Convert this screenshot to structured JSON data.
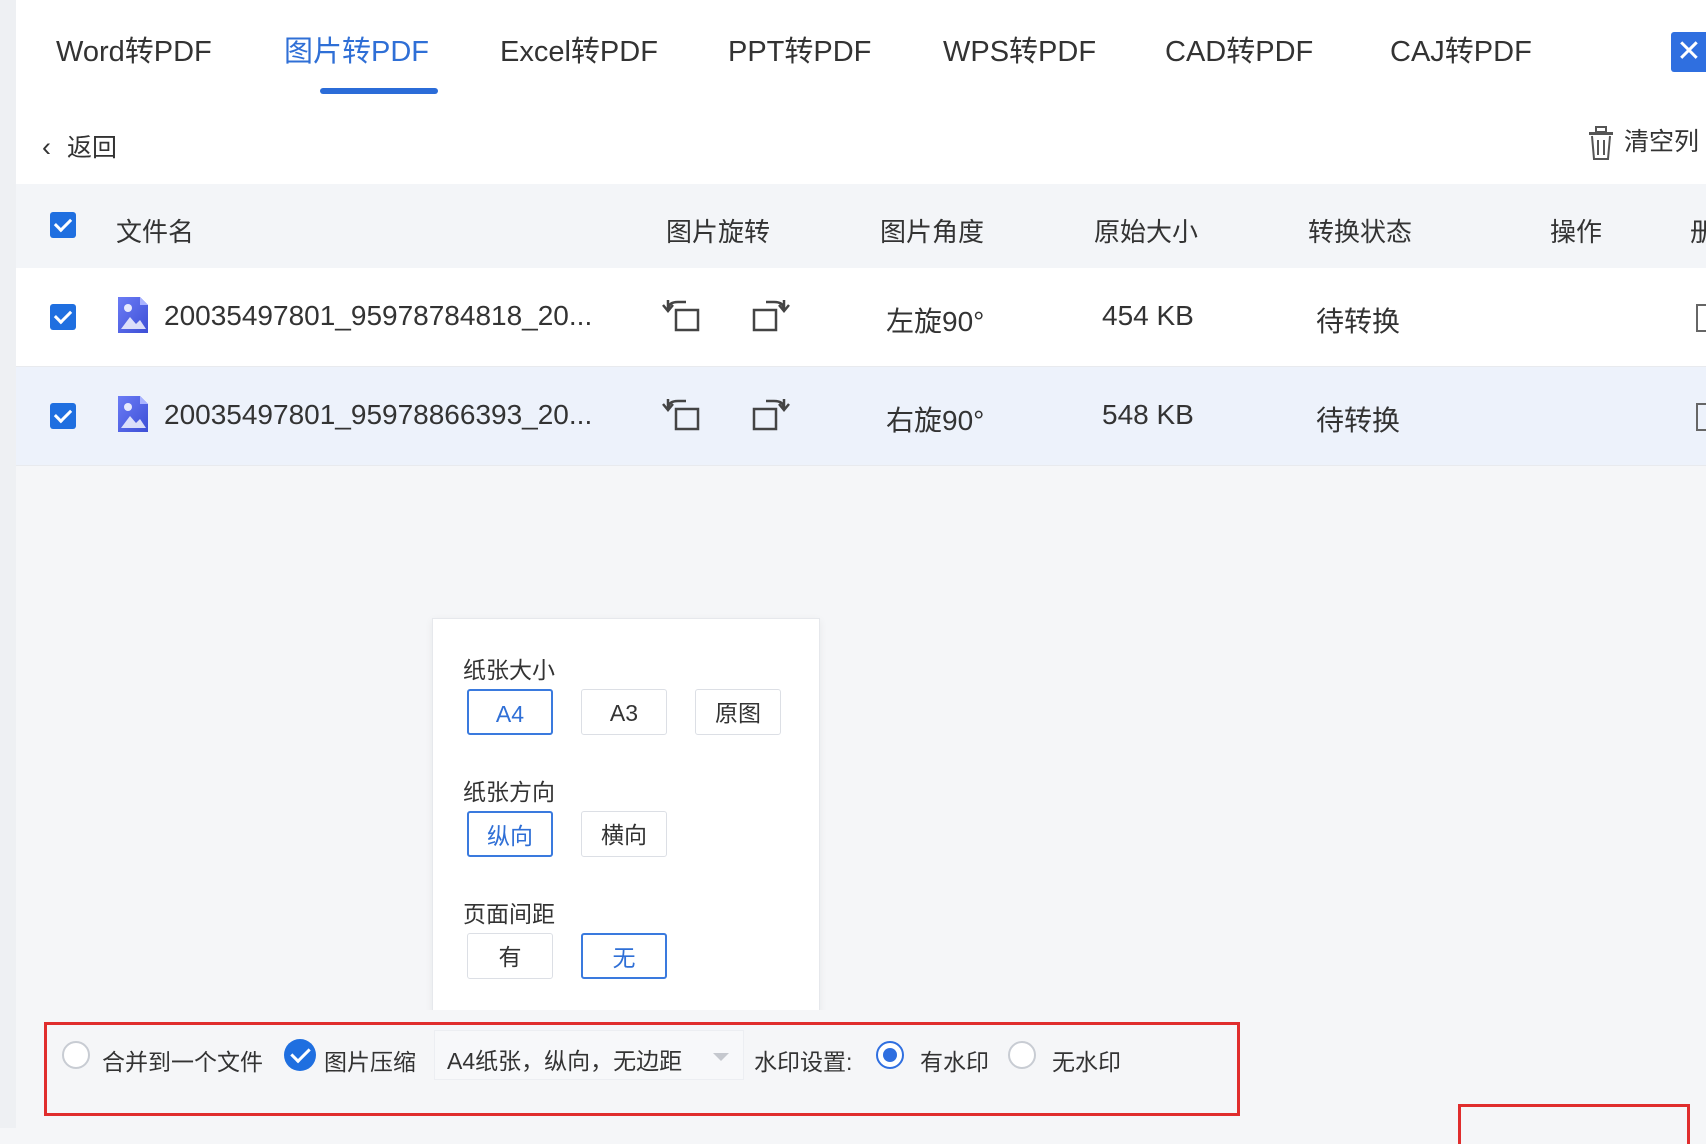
{
  "tabs": [
    {
      "label": "Word转PDF"
    },
    {
      "label": "图片转PDF"
    },
    {
      "label": "Excel转PDF"
    },
    {
      "label": "PPT转PDF"
    },
    {
      "label": "WPS转PDF"
    },
    {
      "label": "CAD转PDF"
    },
    {
      "label": "CAJ转PDF"
    }
  ],
  "active_tab_index": 1,
  "toolbar": {
    "back_label": "返回",
    "clear_label": "清空列"
  },
  "table": {
    "headers": {
      "filename": "文件名",
      "rotate": "图片旋转",
      "angle": "图片角度",
      "size": "原始大小",
      "status": "转换状态",
      "action": "操作",
      "delete": "册"
    },
    "rows": [
      {
        "name": "20035497801_95978784818_20...",
        "angle": "左旋90°",
        "size": "454 KB",
        "status": "待转换"
      },
      {
        "name": "20035497801_95978866393_20...",
        "angle": "右旋90°",
        "size": "548 KB",
        "status": "待转换"
      }
    ]
  },
  "popup": {
    "paper_size": {
      "label": "纸张大小",
      "options": [
        "A4",
        "A3",
        "原图"
      ],
      "selected": "A4"
    },
    "orientation": {
      "label": "纸张方向",
      "options": [
        "纵向",
        "横向"
      ],
      "selected": "纵向"
    },
    "margin": {
      "label": "页面间距",
      "options": [
        "有",
        "无"
      ],
      "selected": "无"
    }
  },
  "bottom": {
    "merge_label": "合并到一个文件",
    "compress_label": "图片压缩",
    "page_setting_value": "A4纸张，纵向，无边距",
    "watermark_label": "水印设置:",
    "watermark_on_label": "有水印",
    "watermark_off_label": "无水印",
    "watermark_selected": "有水印"
  },
  "icons": {
    "tab_close": "close-icon",
    "back": "chevron-left-icon",
    "clear": "trash-icon",
    "file": "image-file-icon",
    "rotate_left": "rotate-left-icon",
    "rotate_right": "rotate-right-icon"
  },
  "colors": {
    "accent": "#2f6fe0",
    "highlight_row": "#edf2fb",
    "annotation_red": "#e02d2d"
  }
}
